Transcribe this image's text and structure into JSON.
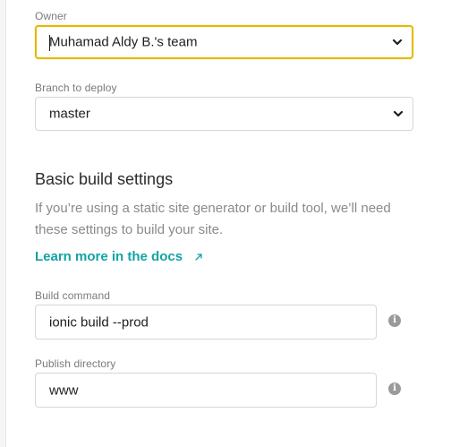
{
  "owner": {
    "label": "Owner",
    "value": "Muhamad Aldy B.'s team"
  },
  "branch": {
    "label": "Branch to deploy",
    "value": "master"
  },
  "basic_build": {
    "title": "Basic build settings",
    "description": "If you’re using a static site generator or build tool, we’ll need these settings to build your site.",
    "docs_link": "Learn more in the docs",
    "docs_link_icon": "external-link-arrow"
  },
  "build_command": {
    "label": "Build command",
    "value": "ionic build --prod",
    "info_icon": "info-icon"
  },
  "publish_directory": {
    "label": "Publish directory",
    "value": "www",
    "info_icon": "info-icon"
  },
  "colors": {
    "focus_border": "#e6b800",
    "link": "#14a3a3",
    "label": "#7a7a7a",
    "text": "#1e1e1e"
  }
}
